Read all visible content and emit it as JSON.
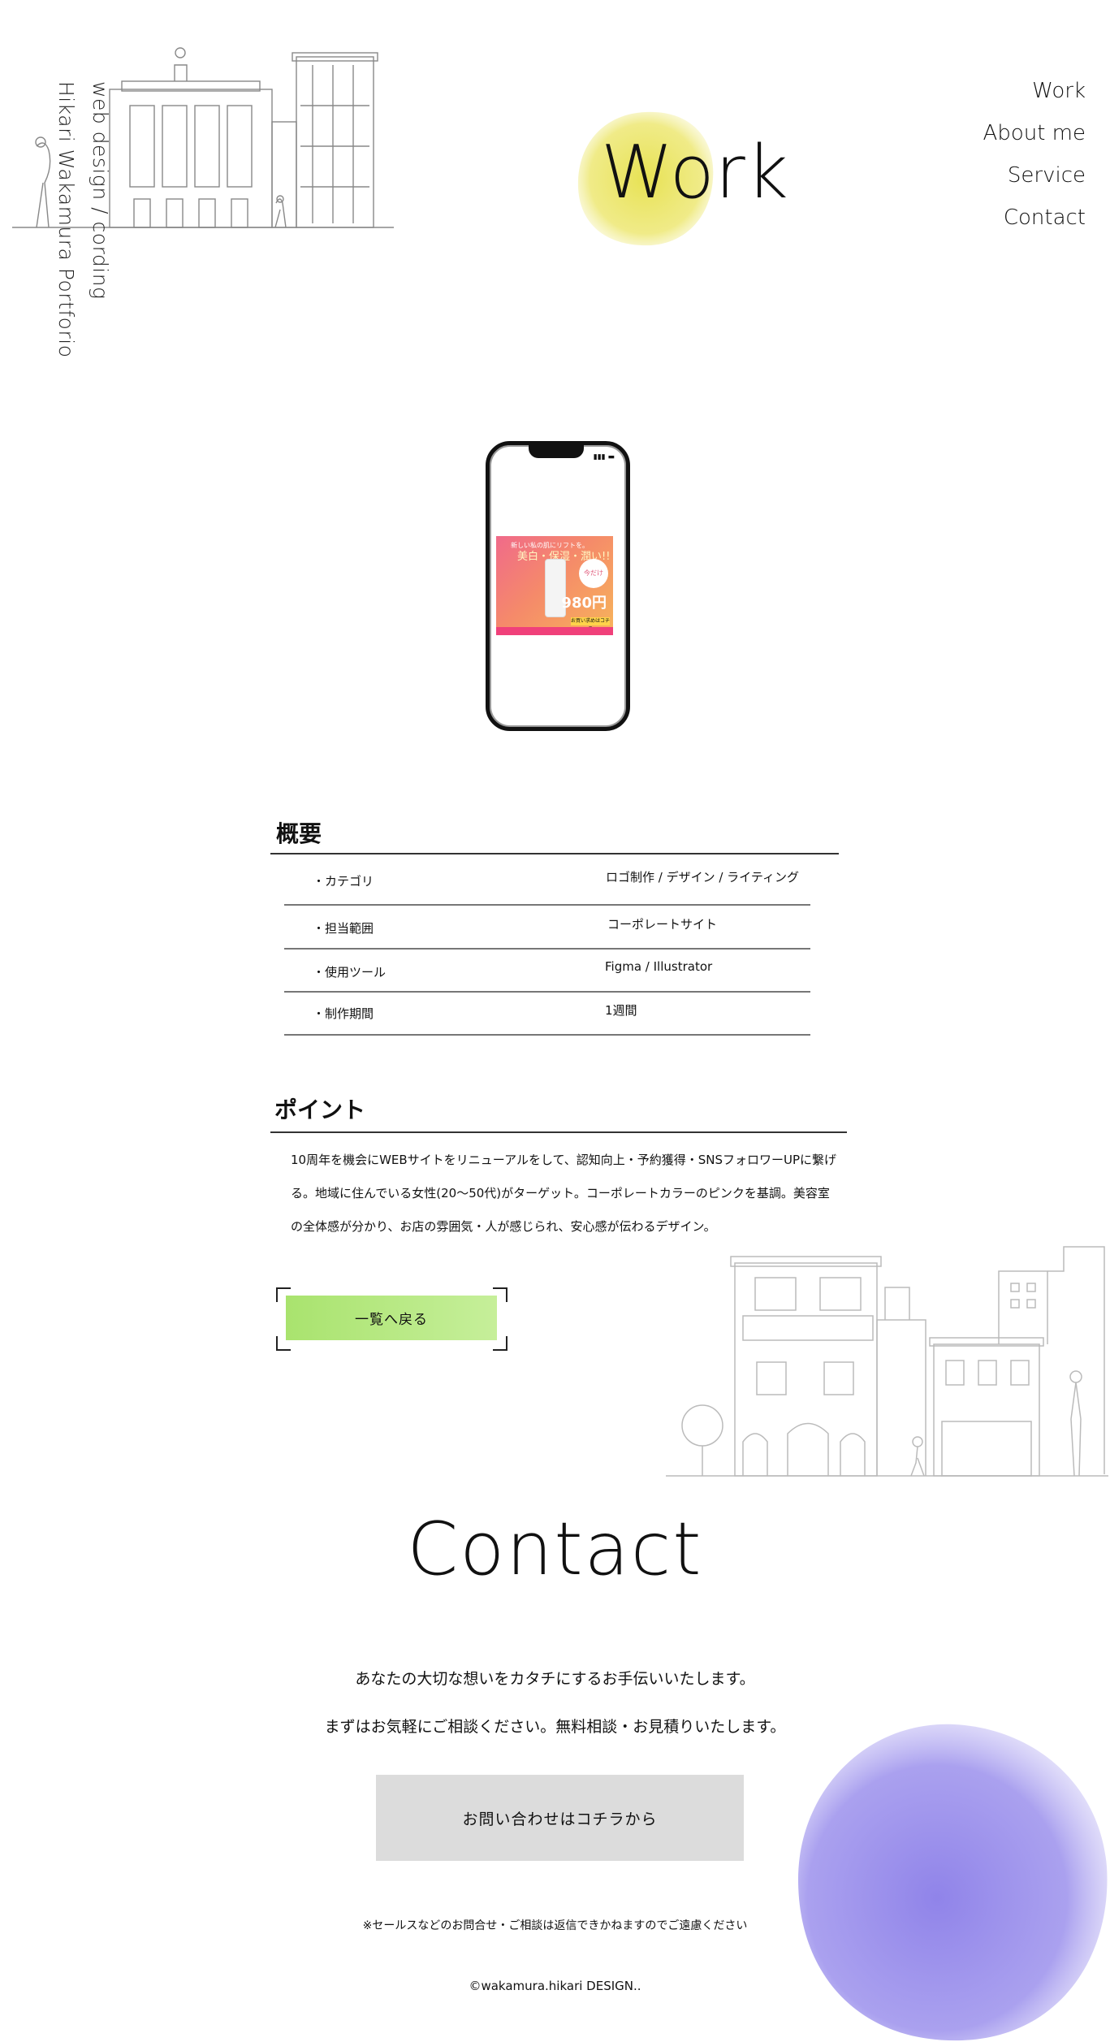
{
  "header": {
    "brand_line1": "web design / cording",
    "brand_line2": "Hikari Wakamura Portforio",
    "page_title": "Work",
    "title_blob_color": "#e6e04a"
  },
  "nav": {
    "items": [
      "Work",
      "About me",
      "Service",
      "Contact"
    ]
  },
  "phone_mock": {
    "ad_top": "新しい私の肌にリフトを。",
    "ad_headline": "美白・保湿・潤い!!",
    "ad_badge": "今だけ",
    "ad_price": "980円",
    "ad_cta": "お買い求めはコチラ"
  },
  "overview": {
    "title": "概要",
    "rows": [
      {
        "label": "・カテゴリ",
        "value": "ロゴ制作 / デザイン / ライティング"
      },
      {
        "label": "・担当範囲",
        "value": "コーポレートサイト"
      },
      {
        "label": "・使用ツール",
        "value": "Figma / Illustrator"
      },
      {
        "label": "・制作期間",
        "value": "1週間"
      }
    ]
  },
  "point": {
    "title": "ポイント",
    "lines": [
      "10周年を機会にWEBサイトをリニューアルをして、認知向上・予約獲得・SNSフォロワーUPに繋げ",
      "る。地域に住んでいる女性(20〜50代)がターゲット。コーポレートカラーのピンクを基調。美容室",
      "の全体感が分かり、お店の雰囲気・人が感じられ、安心感が伝わるデザイン。"
    ]
  },
  "back_button": {
    "label": "一覧へ戻る",
    "color": "#a9e36e"
  },
  "contact": {
    "title": "Contact",
    "line1": "あなたの大切な想いをカタチにするお手伝いいたします。",
    "line2": "まずはお気軽にご相談ください。無料相談・お見積りいたします。",
    "button_label": "お問い合わせはコチラから",
    "note": "※セールスなどのお問合せ・ご相談は返信できかねますのでご遠慮ください",
    "copyright": "©wakamura.hikari DESIGN..",
    "blob_color": "#8a7de8"
  }
}
